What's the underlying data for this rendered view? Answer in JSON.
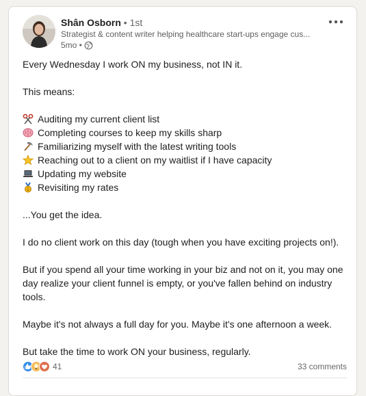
{
  "post": {
    "author": {
      "name": "Shân Osborn",
      "degree": "• 1st",
      "headline": "Strategist & content writer helping healthcare start-ups engage cus...",
      "time": "5mo •",
      "visibility_icon": "globe-icon"
    },
    "menu_icon": "more-options-icon",
    "body": {
      "intro": "Every Wednesday I work ON my business, not IN it.",
      "means": "This means:",
      "list": [
        {
          "icon": "scissors-icon",
          "text": "Auditing my current client list"
        },
        {
          "icon": "brain-icon",
          "text": "Completing courses to keep my skills sharp"
        },
        {
          "icon": "pick-hammer-icon",
          "text": "Familiarizing myself with the latest writing tools"
        },
        {
          "icon": "star-icon",
          "text": "Reaching out to a client on my waitlist if I have capacity"
        },
        {
          "icon": "laptop-icon",
          "text": "Updating my website"
        },
        {
          "icon": "medal-icon",
          "text": "Revisiting my rates"
        }
      ],
      "p1": "...You get the idea.",
      "p2": "I do no client work on this day (tough when you have exciting projects on!).",
      "p3": "But if you spend all your time working in your biz and not on it, you may one day realize your client funnel is empty, or you've fallen behind on industry tools.",
      "p4": "Maybe it's not always a full day for you. Maybe it's one afternoon a week.",
      "p5": "But take the time to work ON your business, regularly."
    },
    "social": {
      "reaction_count": "41",
      "comments": "33 comments",
      "reaction_icons": [
        "like-icon",
        "insightful-icon",
        "love-icon"
      ]
    }
  },
  "colors": {
    "like": "#378fe9",
    "insightful": "#f5bb5c",
    "love": "#df704d"
  }
}
